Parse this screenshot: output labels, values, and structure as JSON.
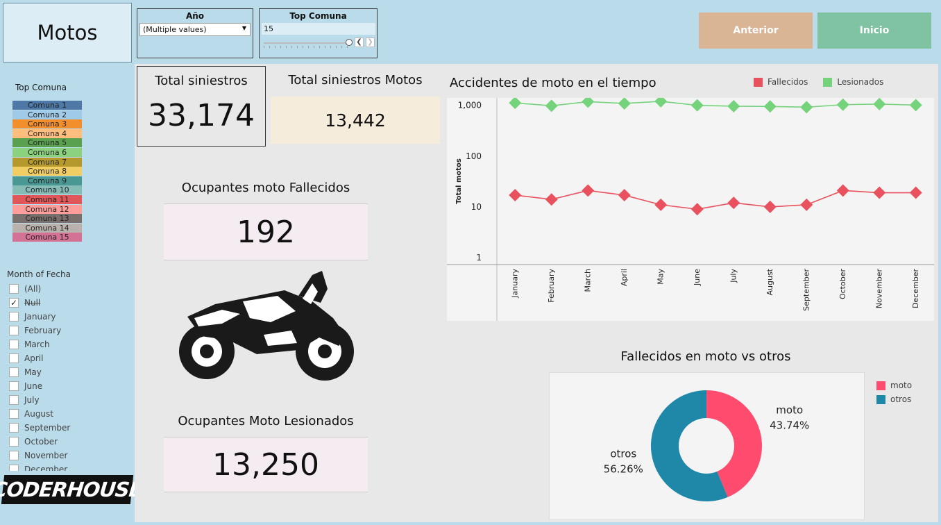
{
  "header": {
    "title": "Motos",
    "year_filter": {
      "title": "Año",
      "selected": "(Multiple values)"
    },
    "top_comuna_filter": {
      "title": "Top Comuna",
      "value": "15"
    },
    "buttons": {
      "previous": "Anterior",
      "home": "Inicio"
    }
  },
  "sidebar": {
    "legend_title": "Top Comuna",
    "comunas": [
      {
        "label": "Comuna 1",
        "color": "#4e79a7"
      },
      {
        "label": "Comuna 2",
        "color": "#a0cbe8"
      },
      {
        "label": "Comuna 3",
        "color": "#f28e2b"
      },
      {
        "label": "Comuna 4",
        "color": "#ffbe7d"
      },
      {
        "label": "Comuna 5",
        "color": "#59a14f"
      },
      {
        "label": "Comuna 6",
        "color": "#8cd17d"
      },
      {
        "label": "Comuna 7",
        "color": "#b6992d"
      },
      {
        "label": "Comuna 8",
        "color": "#f1ce63"
      },
      {
        "label": "Comuna 9",
        "color": "#499894"
      },
      {
        "label": "Comuna 10",
        "color": "#86bcb6"
      },
      {
        "label": "Comuna 11",
        "color": "#e15759"
      },
      {
        "label": "Comuna 12",
        "color": "#ff9d9a"
      },
      {
        "label": "Comuna 13",
        "color": "#79706e"
      },
      {
        "label": "Comuna 14",
        "color": "#bab0ac"
      },
      {
        "label": "Comuna 15",
        "color": "#d37295"
      }
    ],
    "month_filter_title": "Month of Fecha",
    "months": [
      {
        "label": "(All)",
        "checked": false
      },
      {
        "label": "Null",
        "checked": true
      },
      {
        "label": "January",
        "checked": false
      },
      {
        "label": "February",
        "checked": false
      },
      {
        "label": "March",
        "checked": false
      },
      {
        "label": "April",
        "checked": false
      },
      {
        "label": "May",
        "checked": false
      },
      {
        "label": "June",
        "checked": false
      },
      {
        "label": "July",
        "checked": false
      },
      {
        "label": "August",
        "checked": false
      },
      {
        "label": "September",
        "checked": false
      },
      {
        "label": "October",
        "checked": false
      },
      {
        "label": "November",
        "checked": false
      },
      {
        "label": "December",
        "checked": false
      }
    ],
    "logo_text": "CODERHOUSE"
  },
  "kpis": {
    "total_siniestros": {
      "label": "Total siniestros",
      "value": "33,174"
    },
    "total_motos": {
      "label": "Total siniestros Motos",
      "value": "13,442"
    },
    "fallecidos": {
      "label": "Ocupantes moto Fallecidos",
      "value": "192"
    },
    "lesionados": {
      "label": "Ocupantes Moto Lesionados",
      "value": "13,250"
    }
  },
  "line_chart_title": "Accidentes de moto en el tiempo",
  "donut_chart_title": "Fallecidos en moto vs otros",
  "chart_data": [
    {
      "type": "line",
      "title": "Accidentes de moto en el tiempo",
      "ylabel": "Total motos",
      "yscale": "log",
      "ylim": [
        1,
        1400
      ],
      "yticks": [
        "1",
        "10",
        "100",
        "1,000"
      ],
      "legend_position": "top-right",
      "categories": [
        "January",
        "February",
        "March",
        "April",
        "May",
        "June",
        "July",
        "August",
        "September",
        "October",
        "November",
        "December"
      ],
      "series": [
        {
          "name": "Fallecidos",
          "color": "#e8515d",
          "values": [
            17,
            14,
            21,
            17,
            11,
            9,
            12,
            10,
            11,
            21,
            19,
            19
          ]
        },
        {
          "name": "Lesionados",
          "color": "#74d37b",
          "values": [
            1120,
            980,
            1180,
            1090,
            1200,
            1000,
            960,
            950,
            920,
            1030,
            1060,
            1010
          ]
        }
      ]
    },
    {
      "type": "pie",
      "title": "Fallecidos en moto vs otros",
      "legend_position": "right",
      "slices": [
        {
          "name": "moto",
          "value": 43.74,
          "label": "43.74%",
          "color": "#ff4c6e"
        },
        {
          "name": "otros",
          "value": 56.26,
          "label": "56.26%",
          "color": "#1f87a8"
        }
      ]
    }
  ],
  "colors": {
    "previous_button": "#d9b596",
    "home_button": "#7fc3a3",
    "total_motos_bg": "#f5ecdc",
    "kpi_pink_bg": "#f5ecf1"
  }
}
